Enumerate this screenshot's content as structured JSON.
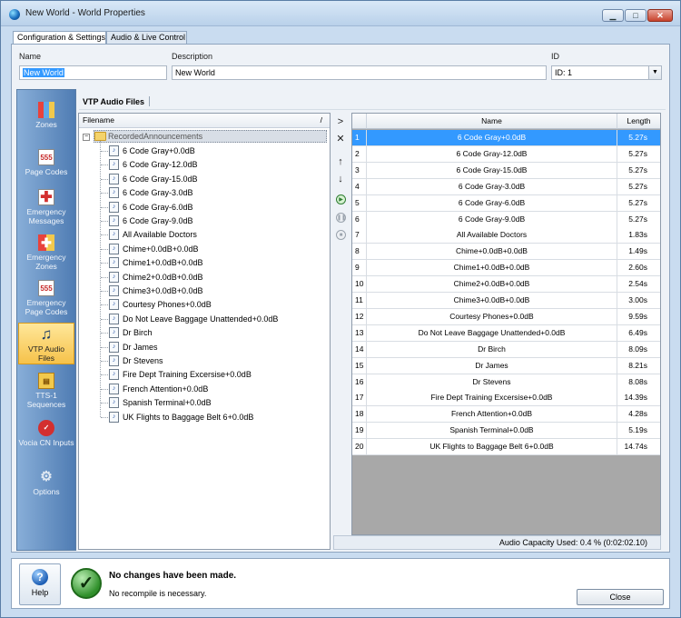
{
  "window": {
    "title": "New World - World Properties",
    "controls": [
      "minimize",
      "maximize",
      "close"
    ]
  },
  "tabs": [
    {
      "label": "Configuration & Settings",
      "active": true
    },
    {
      "label": "Audio & Live Control",
      "active": false
    }
  ],
  "properties": {
    "name_label": "Name",
    "name_value": "New World",
    "description_label": "Description",
    "description_value": "New World",
    "id_label": "ID",
    "id_value": "ID: 1"
  },
  "sidebar": {
    "items": [
      {
        "label": "Zones",
        "icon": "zones-icon"
      },
      {
        "label": "Page Codes",
        "icon": "page-codes-icon"
      },
      {
        "label": "Emergency Messages",
        "icon": "emergency-messages-icon"
      },
      {
        "label": "Emergency Zones",
        "icon": "emergency-zones-icon"
      },
      {
        "label": "Emergency Page Codes",
        "icon": "emergency-page-codes-icon"
      },
      {
        "label": "VTP Audio Files",
        "icon": "music-note-icon",
        "active": true
      },
      {
        "label": "TTS-1 Sequences",
        "icon": "tts-sequences-icon"
      },
      {
        "label": "Vocia CN Inputs",
        "icon": "vocia-inputs-icon"
      },
      {
        "label": "Options",
        "icon": "options-icon"
      }
    ]
  },
  "panel": {
    "title": "VTP Audio Files",
    "tree": {
      "header": "Filename",
      "sort_glyph": "/",
      "root": "RecordedAnnouncements",
      "files": [
        "6 Code Gray+0.0dB",
        "6 Code Gray-12.0dB",
        "6 Code Gray-15.0dB",
        "6 Code Gray-3.0dB",
        "6 Code Gray-6.0dB",
        "6 Code Gray-9.0dB",
        "All Available Doctors",
        "Chime+0.0dB+0.0dB",
        "Chime1+0.0dB+0.0dB",
        "Chime2+0.0dB+0.0dB",
        "Chime3+0.0dB+0.0dB",
        "Courtesy Phones+0.0dB",
        "Do Not Leave Baggage Unattended+0.0dB",
        "Dr Birch",
        "Dr James",
        "Dr Stevens",
        "Fire Dept Training Excersise+0.0dB",
        "French Attention+0.0dB",
        "Spanish Terminal+0.0dB",
        "UK Flights to Baggage Belt 6+0.0dB"
      ]
    },
    "tools": [
      {
        "glyph": ">",
        "icon": "add-arrow-icon"
      },
      {
        "glyph": "✕",
        "icon": "remove-icon"
      },
      {
        "glyph": "↑",
        "icon": "move-up-icon"
      },
      {
        "glyph": "↓",
        "icon": "move-down-icon"
      },
      {
        "glyph": "▶",
        "icon": "play-icon"
      },
      {
        "glyph": "❚❚",
        "icon": "pause-icon"
      },
      {
        "glyph": "■",
        "icon": "stop-icon"
      }
    ],
    "table": {
      "columns": [
        "Name",
        "Length"
      ],
      "rows": [
        {
          "index": "1",
          "name": "6 Code Gray+0.0dB",
          "length": "5.27s"
        },
        {
          "index": "2",
          "name": "6 Code Gray-12.0dB",
          "length": "5.27s"
        },
        {
          "index": "3",
          "name": "6 Code Gray-15.0dB",
          "length": "5.27s"
        },
        {
          "index": "4",
          "name": "6 Code Gray-3.0dB",
          "length": "5.27s"
        },
        {
          "index": "5",
          "name": "6 Code Gray-6.0dB",
          "length": "5.27s"
        },
        {
          "index": "6",
          "name": "6 Code Gray-9.0dB",
          "length": "5.27s"
        },
        {
          "index": "7",
          "name": "All Available Doctors",
          "length": "1.83s"
        },
        {
          "index": "8",
          "name": "Chime+0.0dB+0.0dB",
          "length": "1.49s"
        },
        {
          "index": "9",
          "name": "Chime1+0.0dB+0.0dB",
          "length": "2.60s"
        },
        {
          "index": "10",
          "name": "Chime2+0.0dB+0.0dB",
          "length": "2.54s"
        },
        {
          "index": "11",
          "name": "Chime3+0.0dB+0.0dB",
          "length": "3.00s"
        },
        {
          "index": "12",
          "name": "Courtesy Phones+0.0dB",
          "length": "9.59s"
        },
        {
          "index": "13",
          "name": "Do Not Leave Baggage Unattended+0.0dB",
          "length": "6.49s"
        },
        {
          "index": "14",
          "name": "Dr Birch",
          "length": "8.09s"
        },
        {
          "index": "15",
          "name": "Dr James",
          "length": "8.21s"
        },
        {
          "index": "16",
          "name": "Dr Stevens",
          "length": "8.08s"
        },
        {
          "index": "17",
          "name": "Fire Dept Training Excersise+0.0dB",
          "length": "14.39s"
        },
        {
          "index": "18",
          "name": "French Attention+0.0dB",
          "length": "4.28s"
        },
        {
          "index": "19",
          "name": "Spanish Terminal+0.0dB",
          "length": "5.19s"
        },
        {
          "index": "20",
          "name": "UK Flights to Baggage Belt 6+0.0dB",
          "length": "14.74s"
        }
      ],
      "selected_index": 0
    },
    "capacity": "Audio Capacity Used: 0.4 % (0:02:02.10)"
  },
  "footer": {
    "help_label": "Help",
    "status_title": "No changes have been made.",
    "status_sub": "No recompile is necessary.",
    "close_label": "Close"
  },
  "colors": {
    "selection": "#3399ff",
    "sidebar": "#4f7cb3",
    "active_nav": "#f6c24a",
    "window_frame": "#c9dcf0"
  }
}
